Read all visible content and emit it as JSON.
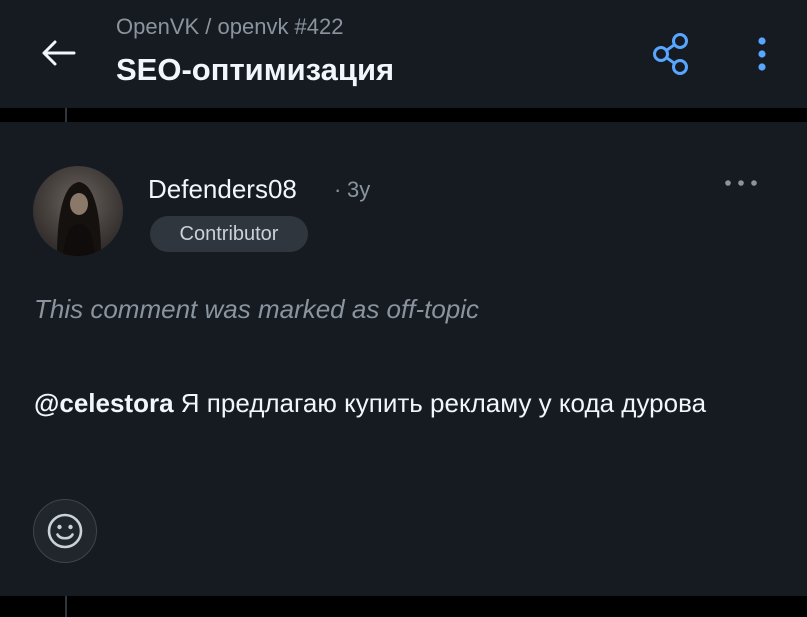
{
  "header": {
    "repo": "OpenVK / openvk #422",
    "title": "SEO-оптимизация",
    "back_icon": "arrow-left-icon",
    "share_icon": "share-icon",
    "menu_icon": "kebab-vertical-icon",
    "accent": "#58a6ff"
  },
  "comment": {
    "author": "Defenders08",
    "separator": "·",
    "age": "3y",
    "badge": "Contributor",
    "more_icon": "kebab-horizontal-icon",
    "off_topic_note": "This comment was marked as off-topic",
    "mention": "@celestora",
    "text": "Я предлагаю купить рекламу у кода дурова",
    "reaction_icon": "smiley-icon"
  },
  "colors": {
    "background": "#000000",
    "surface": "#161b22",
    "muted_text": "#8b949e",
    "primary_text": "#f0f6fc"
  }
}
